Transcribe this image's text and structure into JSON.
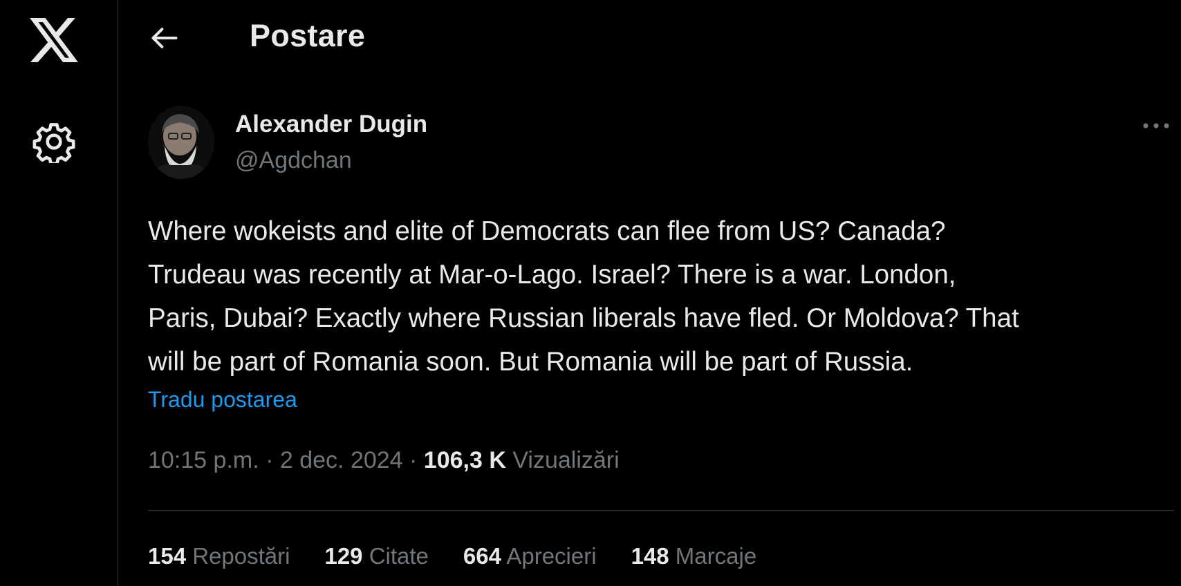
{
  "nav": {
    "logo_icon": "x-logo-icon",
    "settings_icon": "gear-icon"
  },
  "header": {
    "back_icon": "arrow-left-icon",
    "title": "Postare"
  },
  "post": {
    "author": {
      "name": "Alexander Dugin",
      "handle": "@Agdchan"
    },
    "more_icon": "more-horizontal-icon",
    "text_lines": [
      "Where wokeists and elite of Democrats can flee from US? Canada?",
      "Trudeau was recently at Mar-o-Lago. Israel? There is a war. London,",
      "Paris, Dubai? Exactly where Russian liberals have fled. Or Moldova? That",
      "will be part of Romania soon. But Romania will be part of Russia."
    ],
    "translate_label": "Tradu postarea",
    "meta": {
      "time": "10:15 p.m.",
      "sep1": " · ",
      "date": "2 dec. 2024",
      "sep2": " · ",
      "views_count": "106,3 K",
      "views_label": "Vizualizări"
    },
    "stats": [
      {
        "count": "154",
        "label": "Repostări"
      },
      {
        "count": "129",
        "label": "Citate"
      },
      {
        "count": "664",
        "label": "Aprecieri"
      },
      {
        "count": "148",
        "label": "Marcaje"
      }
    ]
  },
  "colors": {
    "background": "#000000",
    "text_primary": "#e7e9ea",
    "text_secondary": "#71767b",
    "link": "#1d9bf0",
    "border": "#2f3336"
  }
}
